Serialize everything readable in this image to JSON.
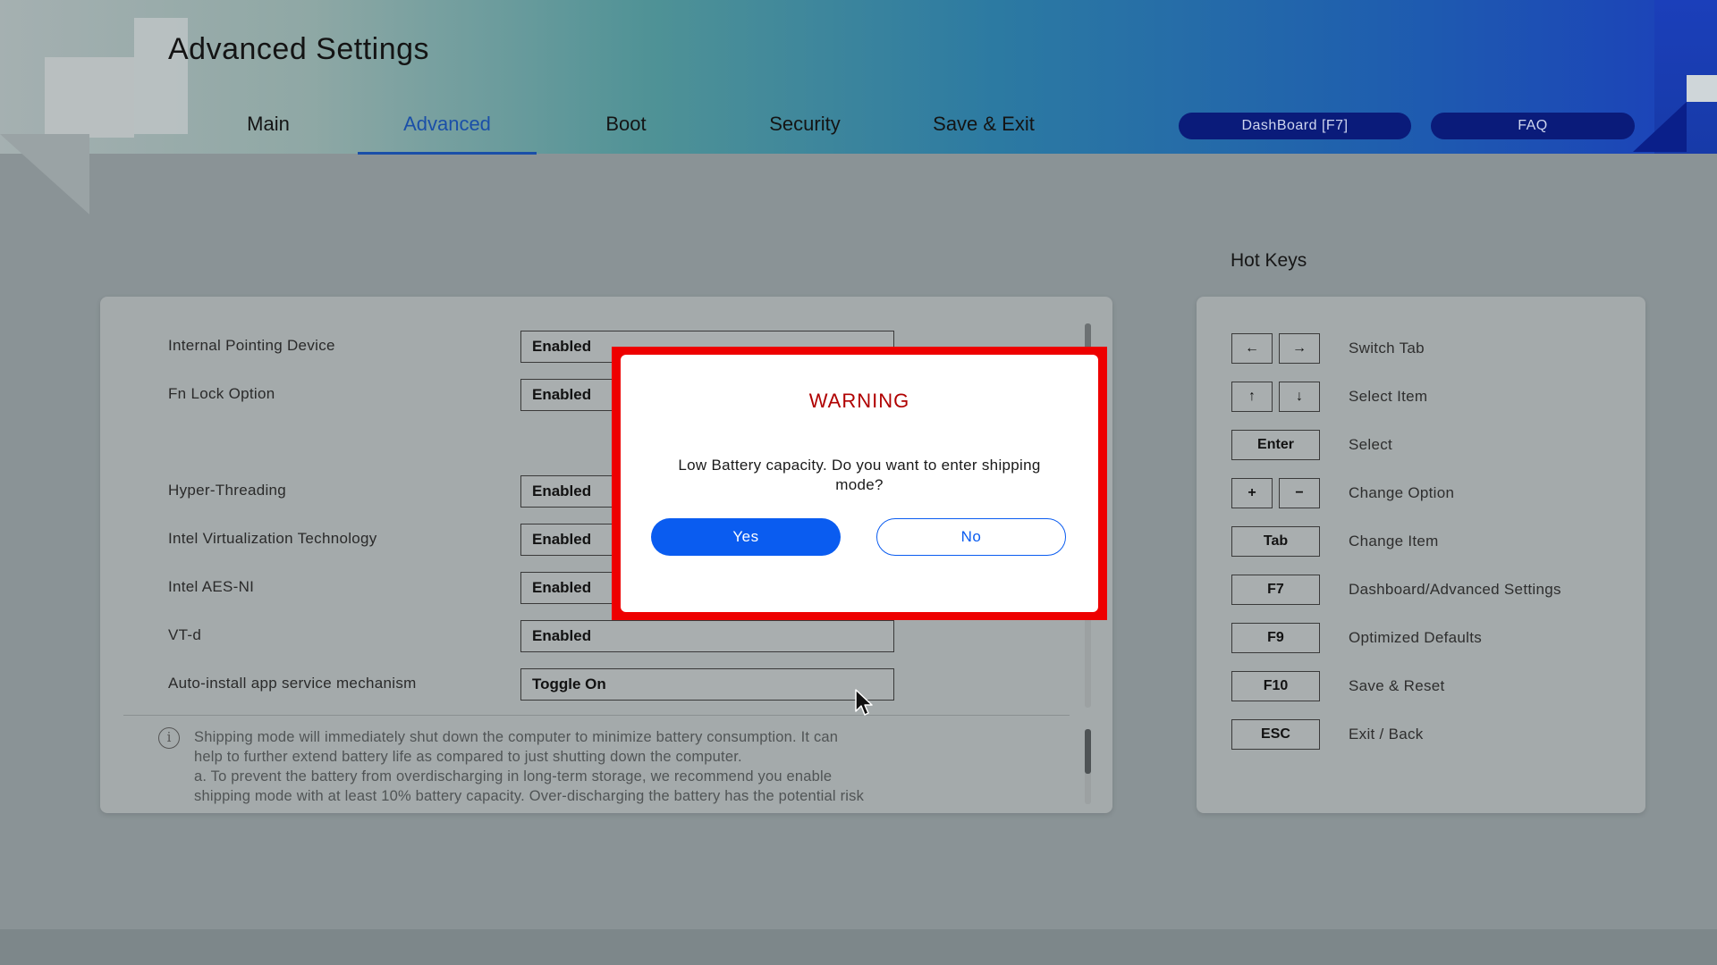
{
  "header": {
    "title": "Advanced Settings",
    "tabs": [
      {
        "label": "Main"
      },
      {
        "label": "Advanced"
      },
      {
        "label": "Boot"
      },
      {
        "label": "Security"
      },
      {
        "label": "Save & Exit"
      }
    ],
    "active_tab": "Advanced",
    "dashboard_label": "DashBoard [F7]",
    "faq_label": "FAQ"
  },
  "settings": [
    {
      "label": "Internal Pointing Device",
      "value": "Enabled"
    },
    {
      "label": "Fn Lock Option",
      "value": "Enabled"
    },
    {
      "label": "Hyper-Threading",
      "value": "Enabled"
    },
    {
      "label": "Intel Virtualization Technology",
      "value": "Enabled"
    },
    {
      "label": "Intel AES-NI",
      "value": "Enabled"
    },
    {
      "label": "VT-d",
      "value": "Enabled"
    },
    {
      "label": "Auto-install app service mechanism",
      "value": "Toggle On"
    }
  ],
  "info": {
    "line1": "Shipping mode will immediately shut down the computer to minimize battery consumption. It can",
    "line2": "help to further extend battery life as compared to just shutting down the computer.",
    "line3": "a. To prevent the battery from overdischarging in long-term storage, we recommend you enable",
    "line4": "shipping mode with at least 10% battery capacity. Over-discharging the battery has the potential risk"
  },
  "hotkeys": {
    "title": "Hot Keys",
    "items": [
      {
        "keys": [
          "←",
          "→"
        ],
        "desc": "Switch Tab"
      },
      {
        "keys": [
          "↑",
          "↓"
        ],
        "desc": "Select Item"
      },
      {
        "keys": [
          "Enter"
        ],
        "desc": "Select"
      },
      {
        "keys": [
          "+",
          "−"
        ],
        "desc": "Change Option"
      },
      {
        "keys": [
          "Tab"
        ],
        "desc": "Change Item"
      },
      {
        "keys": [
          "F7"
        ],
        "desc": "Dashboard/Advanced Settings"
      },
      {
        "keys": [
          "F9"
        ],
        "desc": "Optimized Defaults"
      },
      {
        "keys": [
          "F10"
        ],
        "desc": "Save & Reset"
      },
      {
        "keys": [
          "ESC"
        ],
        "desc": "Exit / Back"
      }
    ]
  },
  "modal": {
    "title": "WARNING",
    "message": "Low Battery capacity. Do you want to enter shipping mode?",
    "yes_label": "Yes",
    "no_label": "No"
  },
  "colors": {
    "accent": "#1a4fa8",
    "pill": "#0a1b7a",
    "warning": "#b00000",
    "highlight": "#ee0000",
    "primary_button": "#0a5cf0"
  }
}
